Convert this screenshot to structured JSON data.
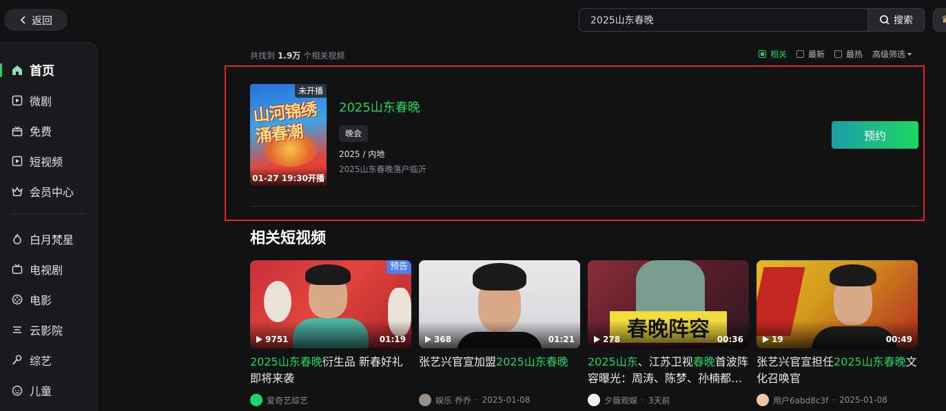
{
  "back": {
    "label": "返回"
  },
  "sidebar": {
    "items": [
      {
        "label": "首页",
        "icon": "home-icon",
        "active": true
      },
      {
        "label": "微剧",
        "icon": "mini-drama-icon"
      },
      {
        "label": "免费",
        "icon": "gift-box-icon"
      },
      {
        "label": "短视频",
        "icon": "play-square-icon"
      },
      {
        "label": "会员中心",
        "icon": "crown-icon"
      },
      {
        "label": "白月梵星",
        "icon": "flame-icon"
      },
      {
        "label": "电视剧",
        "icon": "tv-icon"
      },
      {
        "label": "电影",
        "icon": "film-reel-icon"
      },
      {
        "label": "云影院",
        "icon": "cloud-cinema-icon"
      },
      {
        "label": "综艺",
        "icon": "microphone-icon"
      },
      {
        "label": "儿童",
        "icon": "child-face-icon"
      }
    ]
  },
  "search": {
    "query": "2025山东春晚",
    "button_label": "搜索"
  },
  "results": {
    "prefix": "共找到",
    "count": "1.9万",
    "suffix": "个相关视频",
    "filters": [
      {
        "label": "相关",
        "checked": true
      },
      {
        "label": "最新",
        "checked": false
      },
      {
        "label": "最热",
        "checked": false
      }
    ],
    "advanced_label": "高级筛选"
  },
  "featured": {
    "poster_badge": "未开播",
    "poster_title": "山河锦绣 涌春潮",
    "poster_airtime": "01-27 19:30开播",
    "title": "2025山东春晚",
    "tag": "晚会",
    "meta": "2025 / 内地",
    "description": "2025山东春晚落户临沂",
    "reserve_label": "预约"
  },
  "related": {
    "section_title": "相关短视频",
    "videos": [
      {
        "badge": "预告",
        "plays": "9751",
        "duration": "01:19",
        "title_parts": [
          {
            "text": "2025山东春晚",
            "hl": true
          },
          {
            "text": "衍生品 新春好礼即将来袭",
            "hl": false
          }
        ],
        "author": "爱奇艺综艺",
        "date": ""
      },
      {
        "badge": "",
        "plays": "368",
        "duration": "01:21",
        "title_parts": [
          {
            "text": "张艺兴官宣加盟",
            "hl": false
          },
          {
            "text": "2025山东春晚",
            "hl": true
          }
        ],
        "author": "娱乐 乔乔",
        "date": "2025-01-08"
      },
      {
        "badge": "",
        "plays": "278",
        "duration": "00:36",
        "overlay_text": "春晚阵容",
        "title_parts": [
          {
            "text": "2025山东",
            "hl": true
          },
          {
            "text": "、江苏卫视",
            "hl": false
          },
          {
            "text": "春晚",
            "hl": true
          },
          {
            "text": "首波阵容曝光：周涛、陈梦、孙楠都…",
            "hl": false
          }
        ],
        "author": "夕薇观娱",
        "date": "3天前"
      },
      {
        "badge": "",
        "plays": "19",
        "duration": "00:49",
        "title_parts": [
          {
            "text": "张艺兴官宣担任",
            "hl": false
          },
          {
            "text": "2025山东春晚",
            "hl": true
          },
          {
            "text": "文化召唤官",
            "hl": false
          }
        ],
        "author": "用户6abd8c3f",
        "date": "2025-01-08"
      }
    ]
  },
  "colors": {
    "accent": "#1ed760",
    "highlight_border": "#e0281f",
    "background": "#111214"
  }
}
